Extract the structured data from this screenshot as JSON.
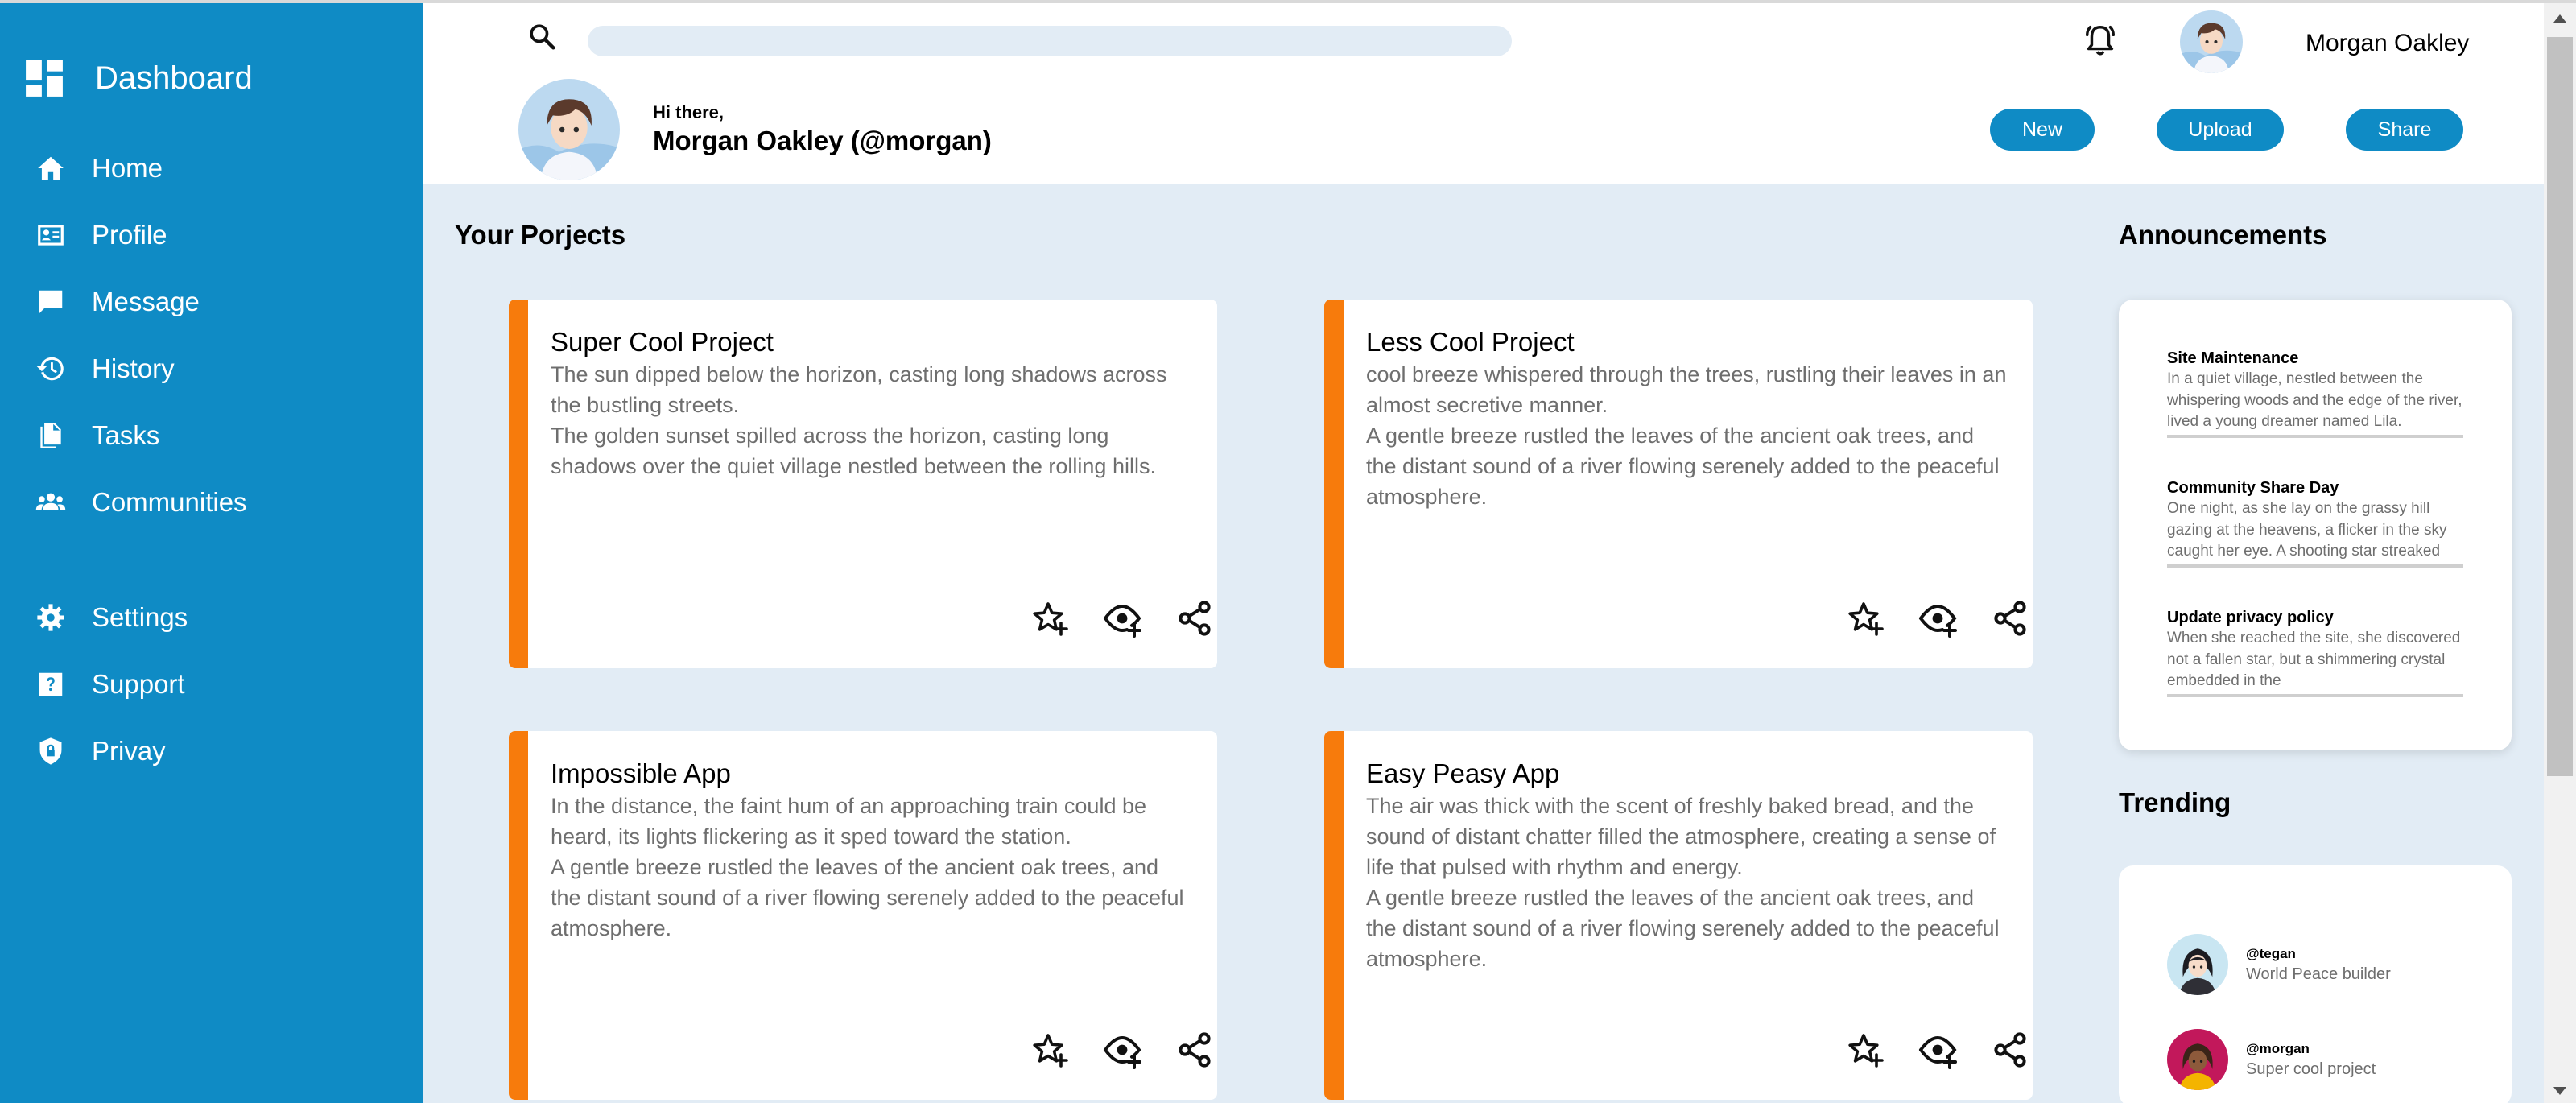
{
  "sidebar": {
    "title": "Dashboard",
    "items": [
      {
        "label": "Home",
        "icon": "home-icon"
      },
      {
        "label": "Profile",
        "icon": "profile-card-icon"
      },
      {
        "label": "Message",
        "icon": "message-icon"
      },
      {
        "label": "History",
        "icon": "history-icon"
      },
      {
        "label": "Tasks",
        "icon": "tasks-icon"
      },
      {
        "label": "Communities",
        "icon": "communities-icon"
      },
      {
        "label": "Settings",
        "icon": "gear-icon"
      },
      {
        "label": "Support",
        "icon": "help-icon"
      },
      {
        "label": "Privay",
        "icon": "shield-lock-icon"
      }
    ]
  },
  "topbar": {
    "search_placeholder": "",
    "username": "Morgan Oakley"
  },
  "hero": {
    "greeting": "Hi there,",
    "fullname": "Morgan Oakley (@morgan)",
    "buttons": {
      "new": "New",
      "upload": "Upload",
      "share": "Share"
    }
  },
  "projects": {
    "title": "Your Porjects",
    "cards": [
      {
        "title": "Super Cool Project",
        "p1": "The sun dipped below the horizon, casting long shadows across the bustling streets.",
        "p2": "The golden sunset spilled across the horizon, casting long shadows over the quiet village nestled between the rolling hills."
      },
      {
        "title": "Less Cool Project",
        "p1": "cool breeze whispered through the trees, rustling their leaves in an almost secretive manner.",
        "p2": "A gentle breeze rustled the leaves of the ancient oak trees, and the distant sound of a river flowing serenely added to the peaceful atmosphere."
      },
      {
        "title": "Impossible App",
        "p1": "In the distance, the faint hum of an approaching train could be heard, its lights flickering as it sped toward the station.",
        "p2": "A gentle breeze rustled the leaves of the ancient oak trees, and the distant sound of a river flowing serenely added to the peaceful atmosphere."
      },
      {
        "title": "Easy Peasy App",
        "p1": "The air was thick with the scent of freshly baked bread, and the sound of distant chatter filled the atmosphere, creating a sense of life that pulsed with rhythm and energy.",
        "p2": "A gentle breeze rustled the leaves of the ancient oak trees, and the distant sound of a river flowing serenely added to the peaceful atmosphere."
      }
    ]
  },
  "announcements": {
    "title": "Announcements",
    "items": [
      {
        "title": "Site Maintenance",
        "text": "In a quiet village, nestled between the whispering woods and the edge of the river, lived a young dreamer named Lila."
      },
      {
        "title": "Community Share Day",
        "text": "One night, as she lay on the grassy hill gazing at the heavens, a flicker in the sky caught her eye. A shooting star streaked"
      },
      {
        "title": "Update privacy policy",
        "text": "When she reached the site, she discovered not a fallen star, but a shimmering crystal embedded in the"
      }
    ]
  },
  "trending": {
    "title": "Trending",
    "items": [
      {
        "handle": "@tegan",
        "desc": "World Peace builder"
      },
      {
        "handle": "@morgan",
        "desc": "Super cool project"
      }
    ]
  },
  "colors": {
    "primary": "#0f8bc5",
    "accent": "#f77b0c",
    "background": "#e2ecf5"
  }
}
